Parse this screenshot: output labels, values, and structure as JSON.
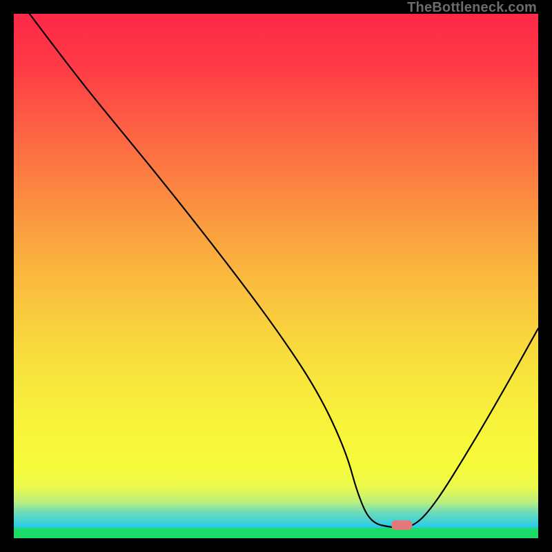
{
  "watermark": "TheBottleneck.com",
  "chart_data": {
    "type": "line",
    "title": "",
    "xlabel": "",
    "ylabel": "",
    "xlim": [
      0,
      100
    ],
    "ylim": [
      0,
      100
    ],
    "grid": false,
    "legend": false,
    "note": "V-shaped bottleneck curve over a vertical red→yellow→green gradient background with a green baseline strip. A small pink marker sits at the trough.",
    "series": [
      {
        "name": "bottleneck-curve",
        "x": [
          3.0,
          12.0,
          21.3,
          30.0,
          40.0,
          50.0,
          58.0,
          63.3,
          65.6,
          68.0,
          72.0,
          76.0,
          80.0,
          86.7,
          93.3,
          100.0
        ],
        "values": [
          100.0,
          88.0,
          76.7,
          66.0,
          53.3,
          40.0,
          28.0,
          16.7,
          8.3,
          3.0,
          2.0,
          2.0,
          6.0,
          16.7,
          28.0,
          40.0
        ]
      }
    ],
    "marker": {
      "name": "optimal-point",
      "x": 74.0,
      "y": 2.5,
      "color": "#e4787b"
    },
    "gradient_stops": [
      {
        "offset": 0,
        "color": "#fe2847"
      },
      {
        "offset": 10,
        "color": "#fe3a46"
      },
      {
        "offset": 20,
        "color": "#fd5a44"
      },
      {
        "offset": 30,
        "color": "#fc7942"
      },
      {
        "offset": 40,
        "color": "#fb9940"
      },
      {
        "offset": 50,
        "color": "#fab63e"
      },
      {
        "offset": 60,
        "color": "#f9cf3d"
      },
      {
        "offset": 70,
        "color": "#f8e43c"
      },
      {
        "offset": 80,
        "color": "#f8f33b"
      },
      {
        "offset": 88,
        "color": "#f7fb3b"
      },
      {
        "offset": 92,
        "color": "#ecfa4b"
      },
      {
        "offset": 95,
        "color": "#bbef7e"
      },
      {
        "offset": 97,
        "color": "#6cdbba"
      },
      {
        "offset": 100,
        "color": "#26caea"
      }
    ],
    "baseline_color": "#1bdc68"
  }
}
